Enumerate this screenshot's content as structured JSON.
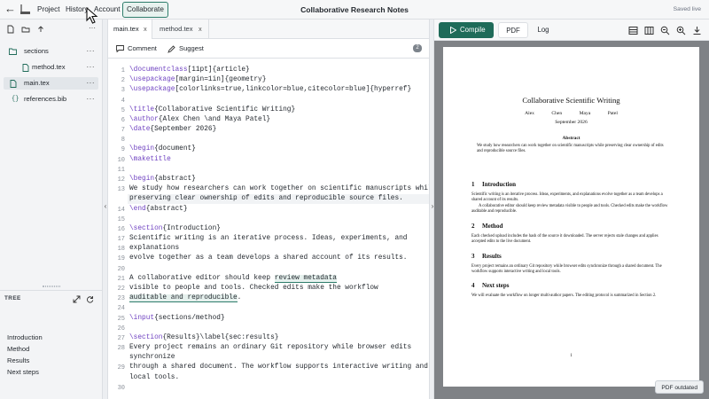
{
  "app": {
    "title": "Collaborative Research Notes",
    "save_status": "Saved live",
    "menu": [
      {
        "label": "Project"
      },
      {
        "label": "History"
      },
      {
        "label": "Account"
      },
      {
        "label": "Collaborate",
        "active": true
      }
    ]
  },
  "sidebar": {
    "files": [
      {
        "name": "sections",
        "type": "folder",
        "more": "···"
      },
      {
        "name": "method.tex",
        "type": "file",
        "more": "···"
      },
      {
        "name": "main.tex",
        "type": "file",
        "selected": true,
        "more": "···"
      },
      {
        "name": "references.bib",
        "type": "bib",
        "more": "···"
      }
    ],
    "outline": {
      "header": "TREE",
      "items": [
        "Introduction",
        "Method",
        "Results",
        "Next steps"
      ]
    }
  },
  "editor": {
    "tabs": [
      {
        "label": "main.tex",
        "close": "x",
        "active": true
      },
      {
        "label": "method.tex",
        "close": "x"
      }
    ],
    "toolbar": {
      "comment": "Comment",
      "suggest": "Suggest",
      "count": "2"
    },
    "lines": [
      {
        "n": "1",
        "text": "\\documentclass[11pt]{article}"
      },
      {
        "n": "2",
        "text": "\\usepackage[margin=1in]{geometry}"
      },
      {
        "n": "3",
        "text": "\\usepackage[colorlinks=true,linkcolor=blue,citecolor=blue]{hyperref}"
      },
      {
        "n": "4",
        "text": ""
      },
      {
        "n": "5",
        "text": "\\title{Collaborative Scientific Writing}"
      },
      {
        "n": "6",
        "text": "\\author{Alex Chen \\and Maya Patel}"
      },
      {
        "n": "7",
        "text": "\\date{September 2026}"
      },
      {
        "n": "8",
        "text": ""
      },
      {
        "n": "9",
        "text": "\\begin{document}"
      },
      {
        "n": "10",
        "text": "\\maketitle"
      },
      {
        "n": "11",
        "text": ""
      },
      {
        "n": "12",
        "text": "\\begin{abstract}"
      },
      {
        "n": "13",
        "text": "We study how researchers can work together on scientific manuscripts while"
      },
      {
        "n": "",
        "text": "preserving clear ownership of edits and reproducible source files."
      },
      {
        "n": "14",
        "text": "\\end{abstract}"
      },
      {
        "n": "15",
        "text": ""
      },
      {
        "n": "16",
        "text": "\\section{Introduction}"
      },
      {
        "n": "17",
        "text": "Scientific writing is an iterative process. Ideas, experiments, and"
      },
      {
        "n": "18",
        "text": "explanations"
      },
      {
        "n": "19",
        "text": "evolve together as a team develops a shared account of its results."
      },
      {
        "n": "20",
        "text": ""
      },
      {
        "n": "21",
        "text": "A collaborative editor should keep review metadata"
      },
      {
        "n": "22",
        "text": "visible to people and tools. Checked edits make the workflow"
      },
      {
        "n": "23",
        "text": "auditable and reproducible."
      },
      {
        "n": "24",
        "text": ""
      },
      {
        "n": "25",
        "text": "\\input{sections/method}"
      },
      {
        "n": "26",
        "text": ""
      },
      {
        "n": "27",
        "text": "\\section{Results}\\label{sec:results}"
      },
      {
        "n": "28",
        "text": "Every project remains an ordinary Git repository while browser edits"
      },
      {
        "n": "",
        "text": "synchronize"
      },
      {
        "n": "29",
        "text": "through a shared document. The workflow supports interactive writing and"
      },
      {
        "n": "",
        "text": "local tools."
      },
      {
        "n": "30",
        "text": ""
      }
    ]
  },
  "preview": {
    "compile_label": "Compile",
    "tabs": [
      {
        "label": "PDF",
        "active": true
      },
      {
        "label": "Log"
      }
    ],
    "status": "PDF outdated",
    "pdf": {
      "title": "Collaborative Scientific Writing",
      "authors": "Alex Chen Maya Patel",
      "date": "September 2026",
      "abstract_heading": "Abstract",
      "abstract": "We study how researchers can work together on scientific manuscripts while preserving clear ownership of edits and reproducible source files.",
      "sections": [
        {
          "num": "1",
          "title": "Introduction",
          "body": "Scientific writing is an iterative process. Ideas, experiments, and explanations evolve together as a team develops a shared account of its results.",
          "body2": "A collaborative editor should keep review metadata visible to people and tools. Checked edits make the workflow auditable and reproducible."
        },
        {
          "num": "2",
          "title": "Method",
          "body": "Each checked upload includes the hash of the source it downloaded. The server rejects stale changes and applies accepted edits to the live document."
        },
        {
          "num": "3",
          "title": "Results",
          "body": "Every project remains an ordinary Git repository while browser edits synchronize through a shared document. The workflow supports interactive writing and local tools."
        },
        {
          "num": "4",
          "title": "Next steps",
          "body": "We will evaluate the workflow on longer multi-author papers. The editing protocol is summarized in Section 2."
        }
      ],
      "page_number": "1"
    }
  },
  "colors": {
    "accent": "#1f6b59",
    "highlight": "#e6f1ee",
    "keyword": "#6f42c1"
  },
  "icons": [
    "back-arrow-icon",
    "project-logo-icon",
    "mouse-pointer-icon",
    "new-file-icon",
    "new-folder-icon",
    "upload-icon",
    "more-icon",
    "folder-icon",
    "file-icon",
    "bib-icon",
    "expand-icon",
    "sync-icon",
    "comment-icon",
    "suggest-icon",
    "play-icon",
    "layout-icon",
    "split-view-icon",
    "zoom-out-icon",
    "zoom-in-icon",
    "download-icon"
  ]
}
